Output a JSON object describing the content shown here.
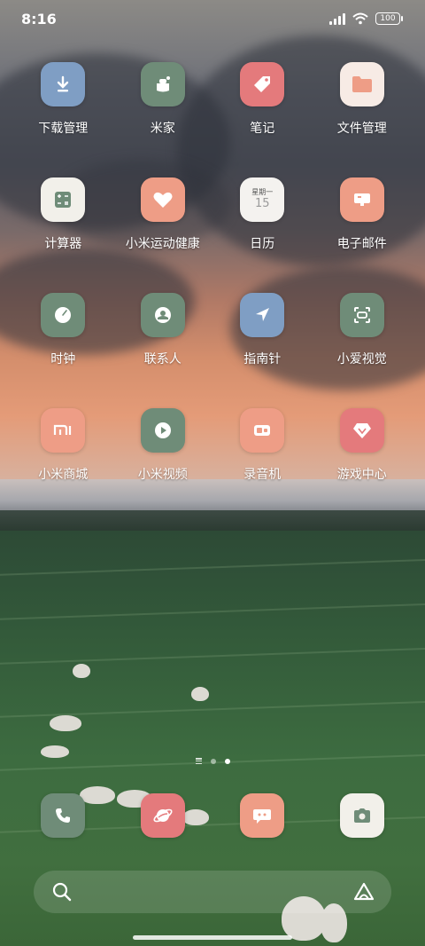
{
  "status_bar": {
    "time": "8:16",
    "battery": "100"
  },
  "apps": [
    {
      "label": "下载管理",
      "icon": "download-icon",
      "color": "#7f9ec4"
    },
    {
      "label": "米家",
      "icon": "mihome-icon",
      "color": "#6f8c78"
    },
    {
      "label": "笔记",
      "icon": "tag-icon",
      "color": "#e47a7c"
    },
    {
      "label": "文件管理",
      "icon": "folder-icon",
      "color": "#f7ebe5"
    },
    {
      "label": "计算器",
      "icon": "calculator-icon",
      "color": "#f2f0ea"
    },
    {
      "label": "小米运动健康",
      "icon": "heart-icon",
      "color": "#ee9d86"
    },
    {
      "label": "日历",
      "icon": "calendar-icon",
      "color": "#f4f2ef",
      "calendar_weekday": "星期一",
      "calendar_day": "15"
    },
    {
      "label": "电子邮件",
      "icon": "mail-icon",
      "color": "#ee9d86"
    },
    {
      "label": "时钟",
      "icon": "clock-icon",
      "color": "#6f8c78"
    },
    {
      "label": "联系人",
      "icon": "contact-icon",
      "color": "#6f8c78"
    },
    {
      "label": "指南针",
      "icon": "compass-icon",
      "color": "#7f9ec4"
    },
    {
      "label": "小爱视觉",
      "icon": "scan-icon",
      "color": "#6f8c78"
    },
    {
      "label": "小米商城",
      "icon": "mi-store-icon",
      "color": "#ee9d86"
    },
    {
      "label": "小米视频",
      "icon": "play-icon",
      "color": "#6f8c78"
    },
    {
      "label": "录音机",
      "icon": "recorder-icon",
      "color": "#ee9d86"
    },
    {
      "label": "游戏中心",
      "icon": "diamond-icon",
      "color": "#e47a7c"
    }
  ],
  "dock": [
    {
      "icon": "phone-icon",
      "color": "#6f8c78"
    },
    {
      "icon": "browser-icon",
      "color": "#e47a7c"
    },
    {
      "icon": "messages-icon",
      "color": "#ee9d86"
    },
    {
      "icon": "camera-icon",
      "color": "#f2f0ea"
    }
  ],
  "page_indicator": {
    "pages": 2,
    "active": 2
  },
  "search": {
    "left_icon": "search-icon",
    "right_icon": "assistant-icon"
  }
}
